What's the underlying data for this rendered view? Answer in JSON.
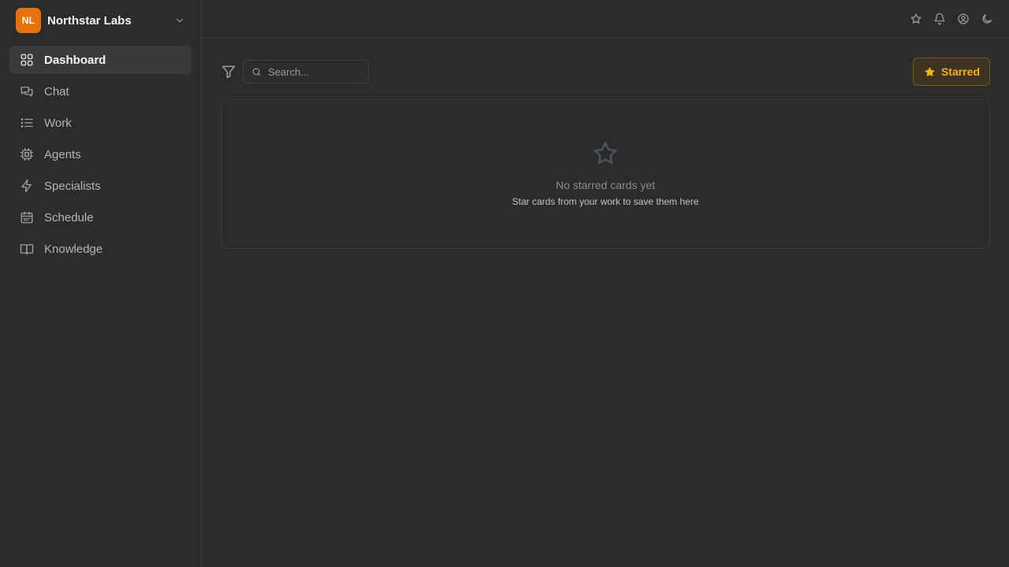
{
  "workspace": {
    "initials": "NL",
    "name": "Northstar Labs",
    "avatar_color": "#e8730c"
  },
  "sidebar": {
    "items": [
      {
        "label": "Dashboard",
        "icon": "grid-icon",
        "active": true
      },
      {
        "label": "Chat",
        "icon": "chat-icon",
        "active": false
      },
      {
        "label": "Work",
        "icon": "list-icon",
        "active": false
      },
      {
        "label": "Agents",
        "icon": "chip-icon",
        "active": false
      },
      {
        "label": "Specialists",
        "icon": "bolt-icon",
        "active": false
      },
      {
        "label": "Schedule",
        "icon": "calendar-icon",
        "active": false
      },
      {
        "label": "Knowledge",
        "icon": "book-icon",
        "active": false
      }
    ]
  },
  "topbar": {
    "icons": [
      "star-icon",
      "bell-icon",
      "user-circle-icon",
      "moon-icon"
    ]
  },
  "toolbar": {
    "search_placeholder": "Search...",
    "search_value": "",
    "starred_label": "Starred",
    "accent_color": "#f5b21a"
  },
  "empty_state": {
    "title": "No starred cards yet",
    "subtitle": "Star cards from your work to save them here"
  }
}
